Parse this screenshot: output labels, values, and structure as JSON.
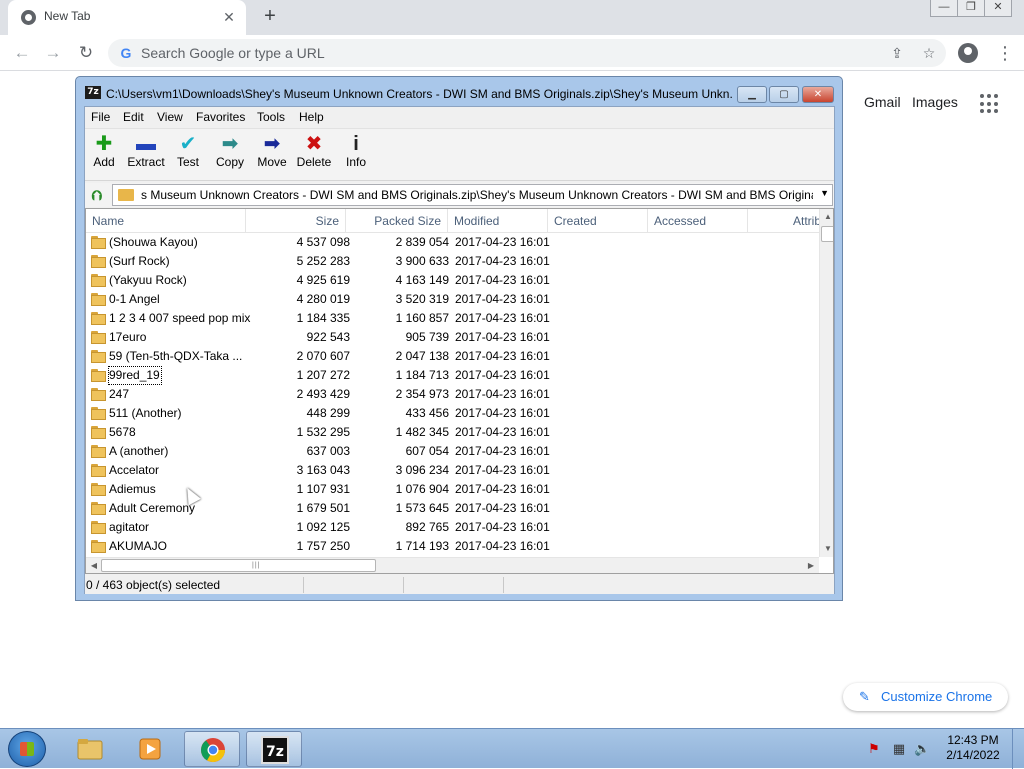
{
  "chrome": {
    "tab_title": "New Tab",
    "tab_close": "✕",
    "new_tab": "+",
    "omnibox_placeholder": "Search Google or type a URL",
    "ntp_links": {
      "gmail": "Gmail",
      "images": "Images"
    },
    "customize_label": "Customize Chrome",
    "window_controls": [
      "—",
      "❐",
      "✕"
    ]
  },
  "zip": {
    "title": "C:\\Users\\vm1\\Downloads\\Shey's Museum Unknown Creators - DWI SM and BMS Originals.zip\\Shey's Museum Unkn...",
    "menu": [
      "File",
      "Edit",
      "View",
      "Favorites",
      "Tools",
      "Help"
    ],
    "toolbar": [
      {
        "label": "Add",
        "icon": "add-icon",
        "glyph": "✚",
        "color": "#1a9a1a"
      },
      {
        "label": "Extract",
        "icon": "extract-icon",
        "glyph": "▬",
        "color": "#2244bb"
      },
      {
        "label": "Test",
        "icon": "test-icon",
        "glyph": "✔",
        "color": "#1ab0c8"
      },
      {
        "label": "Copy",
        "icon": "copy-icon",
        "glyph": "➡",
        "color": "#2c8a8a"
      },
      {
        "label": "Move",
        "icon": "move-icon",
        "glyph": "➡",
        "color": "#1a2a99"
      },
      {
        "label": "Delete",
        "icon": "delete-icon",
        "glyph": "✖",
        "color": "#cc1111"
      },
      {
        "label": "Info",
        "icon": "info-icon",
        "glyph": "i",
        "color": "#222222"
      }
    ],
    "path": "s Museum Unknown Creators - DWI SM and BMS Originals.zip\\Shey's Museum Unknown Creators - DWI SM and BMS Originals\\",
    "columns": [
      "Name",
      "Size",
      "Packed Size",
      "Modified",
      "Created",
      "Accessed",
      "Attrib"
    ],
    "rows": [
      {
        "name": "(Shouwa Kayou)",
        "size": "4 537 098",
        "packed": "2 839 054",
        "modified": "2017-04-23 16:01"
      },
      {
        "name": "(Surf Rock)",
        "size": "5 252 283",
        "packed": "3 900 633",
        "modified": "2017-04-23 16:01"
      },
      {
        "name": "(Yakyuu Rock)",
        "size": "4 925 619",
        "packed": "4 163 149",
        "modified": "2017-04-23 16:01"
      },
      {
        "name": "0-1 Angel",
        "size": "4 280 019",
        "packed": "3 520 319",
        "modified": "2017-04-23 16:01"
      },
      {
        "name": "1 2 3 4 007 speed pop mix",
        "size": "1 184 335",
        "packed": "1 160 857",
        "modified": "2017-04-23 16:01"
      },
      {
        "name": "17euro",
        "size": "922 543",
        "packed": "905 739",
        "modified": "2017-04-23 16:01"
      },
      {
        "name": "59 (Ten-5th-QDX-Taka ...",
        "size": "2 070 607",
        "packed": "2 047 138",
        "modified": "2017-04-23 16:01"
      },
      {
        "name": "99red_19",
        "size": "1 207 272",
        "packed": "1 184 713",
        "modified": "2017-04-23 16:01",
        "focused": true
      },
      {
        "name": "247",
        "size": "2 493 429",
        "packed": "2 354 973",
        "modified": "2017-04-23 16:01"
      },
      {
        "name": "511 (Another)",
        "size": "448 299",
        "packed": "433 456",
        "modified": "2017-04-23 16:01"
      },
      {
        "name": "5678",
        "size": "1 532 295",
        "packed": "1 482 345",
        "modified": "2017-04-23 16:01"
      },
      {
        "name": "A (another)",
        "size": "637 003",
        "packed": "607 054",
        "modified": "2017-04-23 16:01"
      },
      {
        "name": "Accelator",
        "size": "3 163 043",
        "packed": "3 096 234",
        "modified": "2017-04-23 16:01"
      },
      {
        "name": "Adiemus",
        "size": "1 107 931",
        "packed": "1 076 904",
        "modified": "2017-04-23 16:01"
      },
      {
        "name": "Adult Ceremony",
        "size": "1 679 501",
        "packed": "1 573 645",
        "modified": "2017-04-23 16:01"
      },
      {
        "name": "agitator",
        "size": "1 092 125",
        "packed": "892 765",
        "modified": "2017-04-23 16:01"
      },
      {
        "name": "AKUMAJO",
        "size": "1 757 250",
        "packed": "1 714 193",
        "modified": "2017-04-23 16:01"
      }
    ],
    "status": "0 / 463 object(s) selected"
  },
  "taskbar": {
    "clock_time": "12:43 PM",
    "clock_date": "2/14/2022",
    "seven_zip_label": "7z"
  }
}
